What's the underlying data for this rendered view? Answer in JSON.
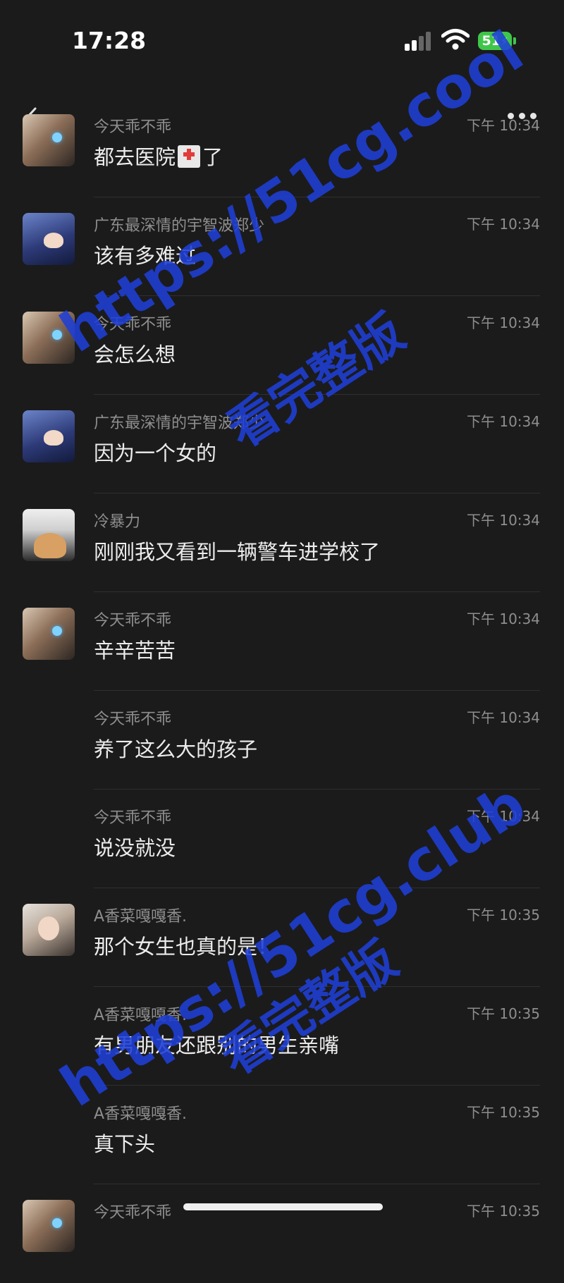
{
  "status_bar": {
    "time": "17:28",
    "battery": "51"
  },
  "messages": [
    {
      "sender": "今天乖不乖",
      "time": "下午 10:34",
      "text_before": "都去医院",
      "text_after": "了",
      "avatar": "a",
      "emoji": "hospital-emoji"
    },
    {
      "sender": "广东最深情的宇智波郑少",
      "time": "下午 10:34",
      "text": "该有多难过",
      "avatar": "b"
    },
    {
      "sender": "今天乖不乖",
      "time": "下午 10:34",
      "text": "会怎么想",
      "avatar": "a"
    },
    {
      "sender": "广东最深情的宇智波郑少",
      "time": "下午 10:34",
      "text": "因为一个女的",
      "avatar": "b"
    },
    {
      "sender": "冷暴力",
      "time": "下午 10:34",
      "text": "刚刚我又看到一辆警车进学校了",
      "avatar": "c"
    },
    {
      "sender": "今天乖不乖",
      "time": "下午 10:34",
      "text": "辛辛苦苦",
      "avatar": "a"
    },
    {
      "sender": "今天乖不乖",
      "time": "下午 10:34",
      "text": "养了这么大的孩子",
      "avatar": ""
    },
    {
      "sender": "今天乖不乖",
      "time": "下午 10:34",
      "text": "说没就没",
      "avatar": ""
    },
    {
      "sender": "A香菜嘎嘎香.",
      "time": "下午 10:35",
      "text": "那个女生也真的是！",
      "avatar": "d"
    },
    {
      "sender": "A香菜嘎嘎香.",
      "time": "下午 10:35",
      "text": "有男朋友还跟别的男生亲嘴",
      "avatar": ""
    },
    {
      "sender": "A香菜嘎嘎香.",
      "time": "下午 10:35",
      "text": "真下头",
      "avatar": ""
    },
    {
      "sender": "今天乖不乖",
      "time": "下午 10:35",
      "text": "",
      "avatar": "a"
    }
  ],
  "watermarks": [
    "https://51cg.cool",
    "看完整版",
    "https://51cg.club",
    "看完整版"
  ],
  "colors": {
    "background": "#1b1b1b",
    "watermark": "#1f3fd6",
    "battery": "#3fc64a"
  }
}
